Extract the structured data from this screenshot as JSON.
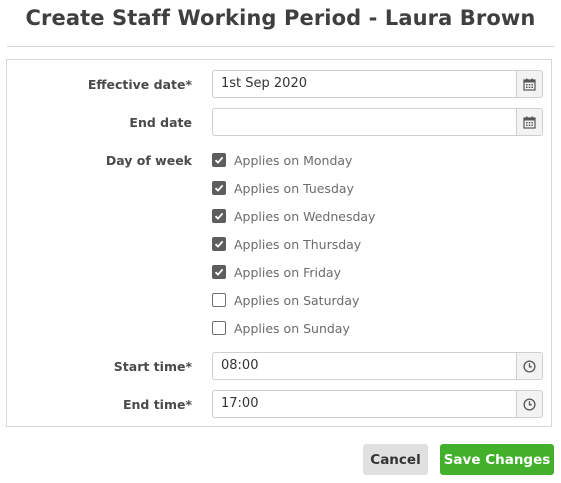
{
  "dialog": {
    "title": "Create Staff Working Period - Laura Brown"
  },
  "form": {
    "effective_date": {
      "label": "Effective date*",
      "value": "1st Sep 2020",
      "icon": "calendar-icon"
    },
    "end_date": {
      "label": "End date",
      "value": "",
      "icon": "calendar-icon"
    },
    "day_of_week": {
      "label": "Day of week",
      "options": [
        {
          "label": "Applies on Monday",
          "checked": true
        },
        {
          "label": "Applies on Tuesday",
          "checked": true
        },
        {
          "label": "Applies on Wednesday",
          "checked": true
        },
        {
          "label": "Applies on Thursday",
          "checked": true
        },
        {
          "label": "Applies on Friday",
          "checked": true
        },
        {
          "label": "Applies on Saturday",
          "checked": false
        },
        {
          "label": "Applies on Sunday",
          "checked": false
        }
      ]
    },
    "start_time": {
      "label": "Start time*",
      "value": "08:00",
      "icon": "clock-icon"
    },
    "end_time": {
      "label": "End time*",
      "value": "17:00",
      "icon": "clock-icon"
    }
  },
  "actions": {
    "cancel_label": "Cancel",
    "save_label": "Save Changes"
  },
  "colors": {
    "save_button": "#42b02a",
    "cancel_button": "#e0e0e0",
    "checkbox_checked": "#5d5d5d"
  }
}
